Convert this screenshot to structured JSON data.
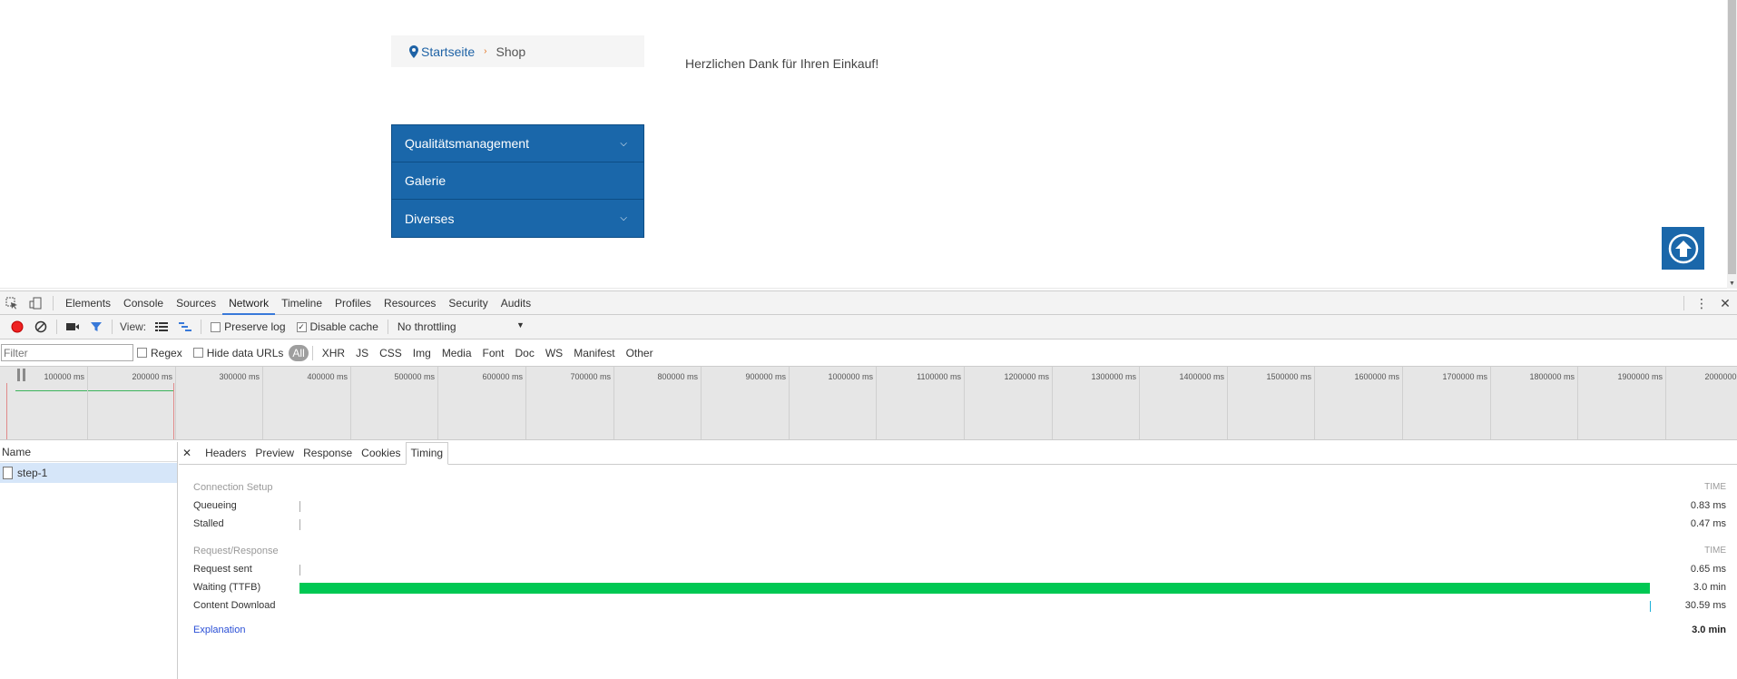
{
  "page": {
    "breadcrumb": {
      "home": "Startseite",
      "separator": "›",
      "current": "Shop"
    },
    "thanks_message": "Herzlichen Dank für Ihren Einkauf!",
    "menu": [
      {
        "label": "Qualitätsmanagement",
        "has_children": true
      },
      {
        "label": "Galerie",
        "has_children": false
      },
      {
        "label": "Diverses",
        "has_children": true
      }
    ],
    "accent_color": "#1a67aa"
  },
  "devtools": {
    "tabs": [
      "Elements",
      "Console",
      "Sources",
      "Network",
      "Timeline",
      "Profiles",
      "Resources",
      "Security",
      "Audits"
    ],
    "active_tab": "Network",
    "toolbar": {
      "view_label": "View:",
      "preserve_log": "Preserve log",
      "preserve_log_checked": false,
      "disable_cache": "Disable cache",
      "disable_cache_checked": true,
      "throttling": "No throttling"
    },
    "filter": {
      "placeholder": "Filter",
      "regex": "Regex",
      "hide_data_urls": "Hide data URLs",
      "types": [
        "All",
        "XHR",
        "JS",
        "CSS",
        "Img",
        "Media",
        "Font",
        "Doc",
        "WS",
        "Manifest",
        "Other"
      ],
      "active_type": "All"
    },
    "overview_ticks": [
      "100000 ms",
      "200000 ms",
      "300000 ms",
      "400000 ms",
      "500000 ms",
      "600000 ms",
      "700000 ms",
      "800000 ms",
      "900000 ms",
      "1000000 ms",
      "1100000 ms",
      "1200000 ms",
      "1300000 ms",
      "1400000 ms",
      "1500000 ms",
      "1600000 ms",
      "1700000 ms",
      "1800000 ms",
      "1900000 ms",
      "2000000 ms"
    ],
    "requests": {
      "header": "Name",
      "items": [
        {
          "name": "step-1"
        }
      ]
    },
    "detail_tabs": [
      "Headers",
      "Preview",
      "Response",
      "Cookies",
      "Timing"
    ],
    "active_detail_tab": "Timing",
    "timing": {
      "connection_setup": "Connection Setup",
      "request_response": "Request/Response",
      "time_header": "TIME",
      "rows": [
        {
          "label": "Queueing",
          "value": "0.83 ms"
        },
        {
          "label": "Stalled",
          "value": "0.47 ms"
        },
        {
          "label": "Request sent",
          "value": "0.65 ms"
        },
        {
          "label": "Waiting (TTFB)",
          "value": "3.0 min"
        },
        {
          "label": "Content Download",
          "value": "30.59 ms"
        }
      ],
      "waiting_fraction": 1.0,
      "waiting_color": "#00c853",
      "explanation": "Explanation",
      "total": "3.0 min"
    }
  }
}
